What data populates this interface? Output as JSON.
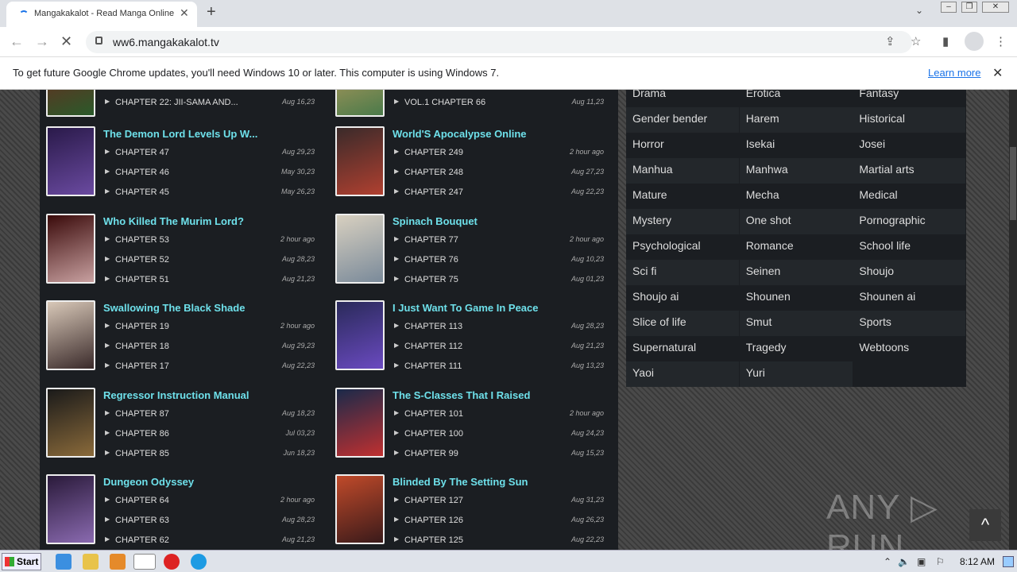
{
  "browser": {
    "tab_title": "Mangakakalot - Read Manga Online F",
    "url": "ww6.mangakakalot.tv",
    "new_tab": "+",
    "close_tab": "✕",
    "tab_menu": "⌄"
  },
  "infobar": {
    "message": "To get future Google Chrome updates, you'll need Windows 10 or later. This computer is using Windows 7.",
    "learn_more": "Learn more",
    "close": "✕"
  },
  "manga_left": [
    {
      "chapters": [
        {
          "name": "CHAPTER 22: JII-SAMA AND...",
          "date": "Aug 16,23"
        }
      ]
    },
    {
      "title": "The Demon Lord Levels Up W...",
      "chapters": [
        {
          "name": "CHAPTER 47",
          "date": "Aug 29,23"
        },
        {
          "name": "CHAPTER 46",
          "date": "May 30,23"
        },
        {
          "name": "CHAPTER 45",
          "date": "May 26,23"
        }
      ]
    },
    {
      "title": "Who Killed The Murim Lord?",
      "chapters": [
        {
          "name": "CHAPTER 53",
          "date": "2 hour ago"
        },
        {
          "name": "CHAPTER 52",
          "date": "Aug 28,23"
        },
        {
          "name": "CHAPTER 51",
          "date": "Aug 21,23"
        }
      ]
    },
    {
      "title": "Swallowing The Black Shade",
      "chapters": [
        {
          "name": "CHAPTER 19",
          "date": "2 hour ago"
        },
        {
          "name": "CHAPTER 18",
          "date": "Aug 29,23"
        },
        {
          "name": "CHAPTER 17",
          "date": "Aug 22,23"
        }
      ]
    },
    {
      "title": "Regressor Instruction Manual",
      "chapters": [
        {
          "name": "CHAPTER 87",
          "date": "Aug 18,23"
        },
        {
          "name": "CHAPTER 86",
          "date": "Jul 03,23"
        },
        {
          "name": "CHAPTER 85",
          "date": "Jun 18,23"
        }
      ]
    },
    {
      "title": "Dungeon Odyssey",
      "chapters": [
        {
          "name": "CHAPTER 64",
          "date": "2 hour ago"
        },
        {
          "name": "CHAPTER 63",
          "date": "Aug 28,23"
        },
        {
          "name": "CHAPTER 62",
          "date": "Aug 21,23"
        }
      ]
    }
  ],
  "manga_right": [
    {
      "chapters": [
        {
          "name": "VOL.1 CHAPTER 66",
          "date": "Aug 11,23"
        }
      ]
    },
    {
      "title": "World'S Apocalypse Online",
      "chapters": [
        {
          "name": "CHAPTER 249",
          "date": "2 hour ago"
        },
        {
          "name": "CHAPTER 248",
          "date": "Aug 27,23"
        },
        {
          "name": "CHAPTER 247",
          "date": "Aug 22,23"
        }
      ]
    },
    {
      "title": "Spinach Bouquet",
      "chapters": [
        {
          "name": "CHAPTER 77",
          "date": "2 hour ago"
        },
        {
          "name": "CHAPTER 76",
          "date": "Aug 10,23"
        },
        {
          "name": "CHAPTER 75",
          "date": "Aug 01,23"
        }
      ]
    },
    {
      "title": "I Just Want To Game In Peace",
      "chapters": [
        {
          "name": "CHAPTER 113",
          "date": "Aug 28,23"
        },
        {
          "name": "CHAPTER 112",
          "date": "Aug 21,23"
        },
        {
          "name": "CHAPTER 111",
          "date": "Aug 13,23"
        }
      ]
    },
    {
      "title": "The S-Classes That I Raised",
      "chapters": [
        {
          "name": "CHAPTER 101",
          "date": "2 hour ago"
        },
        {
          "name": "CHAPTER 100",
          "date": "Aug 24,23"
        },
        {
          "name": "CHAPTER 99",
          "date": "Aug 15,23"
        }
      ]
    },
    {
      "title": "Blinded By The Setting Sun",
      "chapters": [
        {
          "name": "CHAPTER 127",
          "date": "Aug 31,23"
        },
        {
          "name": "CHAPTER 126",
          "date": "Aug 26,23"
        },
        {
          "name": "CHAPTER 125",
          "date": "Aug 22,23"
        }
      ]
    }
  ],
  "genres": [
    "Drama",
    "Erotica",
    "Fantasy",
    "Gender bender",
    "Harem",
    "Historical",
    "Horror",
    "Isekai",
    "Josei",
    "Manhua",
    "Manhwa",
    "Martial arts",
    "Mature",
    "Mecha",
    "Medical",
    "Mystery",
    "One shot",
    "Pornographic",
    "Psychological",
    "Romance",
    "School life",
    "Sci fi",
    "Seinen",
    "Shoujo",
    "Shoujo ai",
    "Shounen",
    "Shounen ai",
    "Slice of life",
    "Smut",
    "Sports",
    "Supernatural",
    "Tragedy",
    "Webtoons",
    "Yaoi",
    "Yuri"
  ],
  "watermark": "ANY ▷ RUN",
  "taskbar": {
    "start": "Start",
    "clock": "8:12 AM"
  },
  "colors": {
    "title": "#6ee0ea",
    "panel": "#1b1e22"
  }
}
